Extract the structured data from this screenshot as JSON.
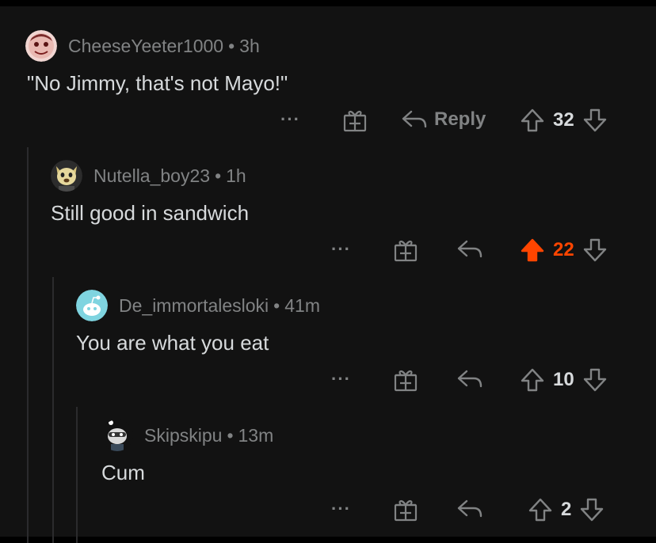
{
  "comments": [
    {
      "username": "CheeseYeeter1000",
      "time": "3h",
      "text": "\"No Jimmy, that's not Mayo!\"",
      "reply_label": "Reply",
      "score": "32",
      "upvoted": false,
      "avatar": "pink-face-avatar"
    },
    {
      "username": "Nutella_boy23",
      "time": "1h",
      "text": "Still good in sandwich",
      "score": "22",
      "upvoted": true,
      "avatar": "dog-avatar"
    },
    {
      "username": "De_immortalesloki",
      "time": "41m",
      "text": "You are what you eat",
      "score": "10",
      "upvoted": false,
      "avatar": "default-snoo-avatar"
    },
    {
      "username": "Skipskipu",
      "time": "13m",
      "text": "Cum",
      "score": "2",
      "upvoted": false,
      "avatar": "snoo-avatar"
    }
  ],
  "separator": "•",
  "more_label": "···",
  "colors": {
    "background": "#121212",
    "text": "#d7dadc",
    "meta": "#818384",
    "upvote_active": "#ff4500",
    "thread_line": "#2b2b2d"
  }
}
